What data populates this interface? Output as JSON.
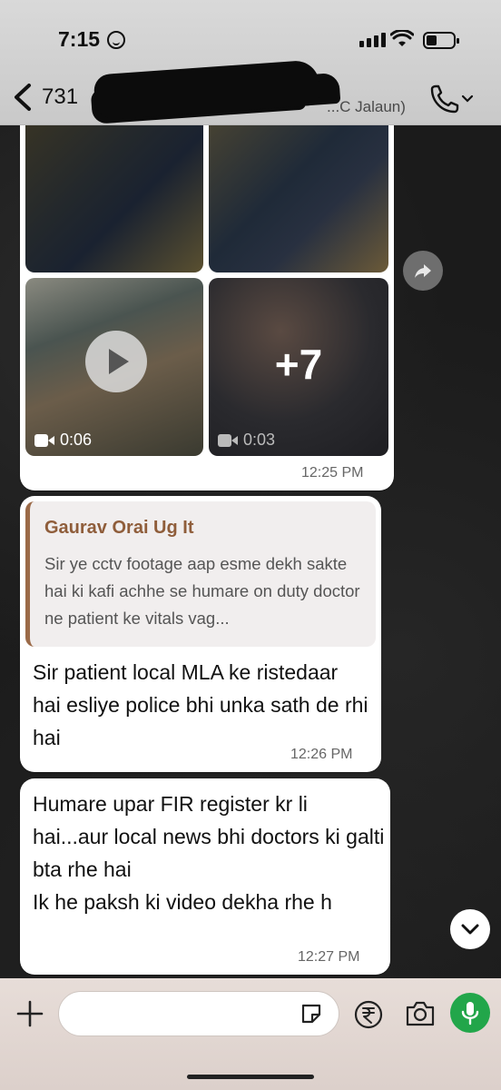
{
  "status_bar": {
    "time": "7:15"
  },
  "header": {
    "contact_number": "731",
    "contact_subtitle": "...C Jalaun)"
  },
  "media_group": {
    "videos": [
      {
        "duration": "0:06"
      },
      {
        "duration": "0:03"
      }
    ],
    "more_count": "+7",
    "timestamp": "12:25 PM"
  },
  "reply_message": {
    "quoted_author": "Gaurav Orai Ug It",
    "quoted_text": "Sir ye cctv footage aap esme dekh sakte hai ki kafi achhe se humare on duty doctor ne patient ke vitals vag...",
    "text": "Sir patient local MLA ke ristedaar hai esliye police bhi unka sath de rhi hai",
    "timestamp": "12:26 PM"
  },
  "message3": {
    "text_line1": "Humare upar FIR register kr li hai...aur local news bhi doctors ki galti bta rhe hai",
    "text_line2": "Ik he paksh ki video dekha rhe h",
    "timestamp": "12:27 PM"
  },
  "input_bar": {
    "placeholder": ""
  },
  "colors": {
    "quote_accent": "#9b6a48",
    "mic_button": "#22a64a",
    "avatar_ring": "#25a244"
  }
}
